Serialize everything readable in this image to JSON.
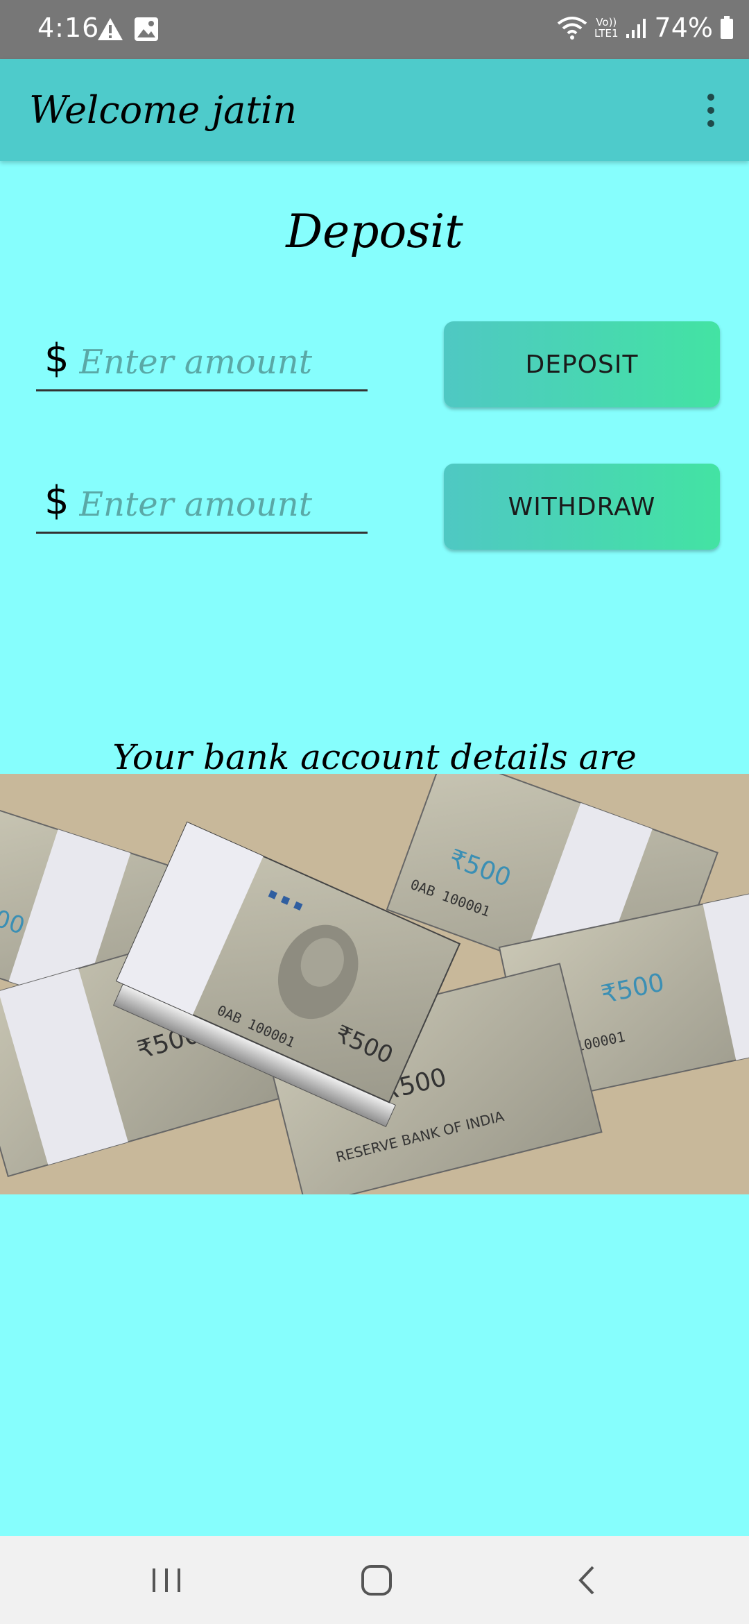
{
  "status_bar": {
    "time": "4:16",
    "network_label_top": "Vo))",
    "network_label_bottom": "LTE1",
    "battery": "74%"
  },
  "app_bar": {
    "title": "Welcome jatin",
    "menu_icon": "more-vert-icon"
  },
  "main": {
    "heading": "Deposit",
    "deposit_field": {
      "currency": "$",
      "placeholder": "Enter amount",
      "value": ""
    },
    "withdraw_field": {
      "currency": "$",
      "placeholder": "Enter amount",
      "value": ""
    },
    "deposit_button": "DEPOSIT",
    "withdraw_button": "WITHDRAW",
    "details_label": "Your bank account details are"
  },
  "banknote_texts": [
    "₹500",
    "0AB 100001",
    "RESERVE BANK OF INDIA"
  ],
  "nav_bar": {
    "recents_icon": "recents-icon",
    "home_icon": "home-icon",
    "back_icon": "back-icon"
  },
  "colors": {
    "background": "#86fefd",
    "app_bar": "#4ecbcb",
    "button_gradient_start": "#4fc8c3",
    "button_gradient_end": "#43e3a3",
    "status_bar": "#777777"
  }
}
